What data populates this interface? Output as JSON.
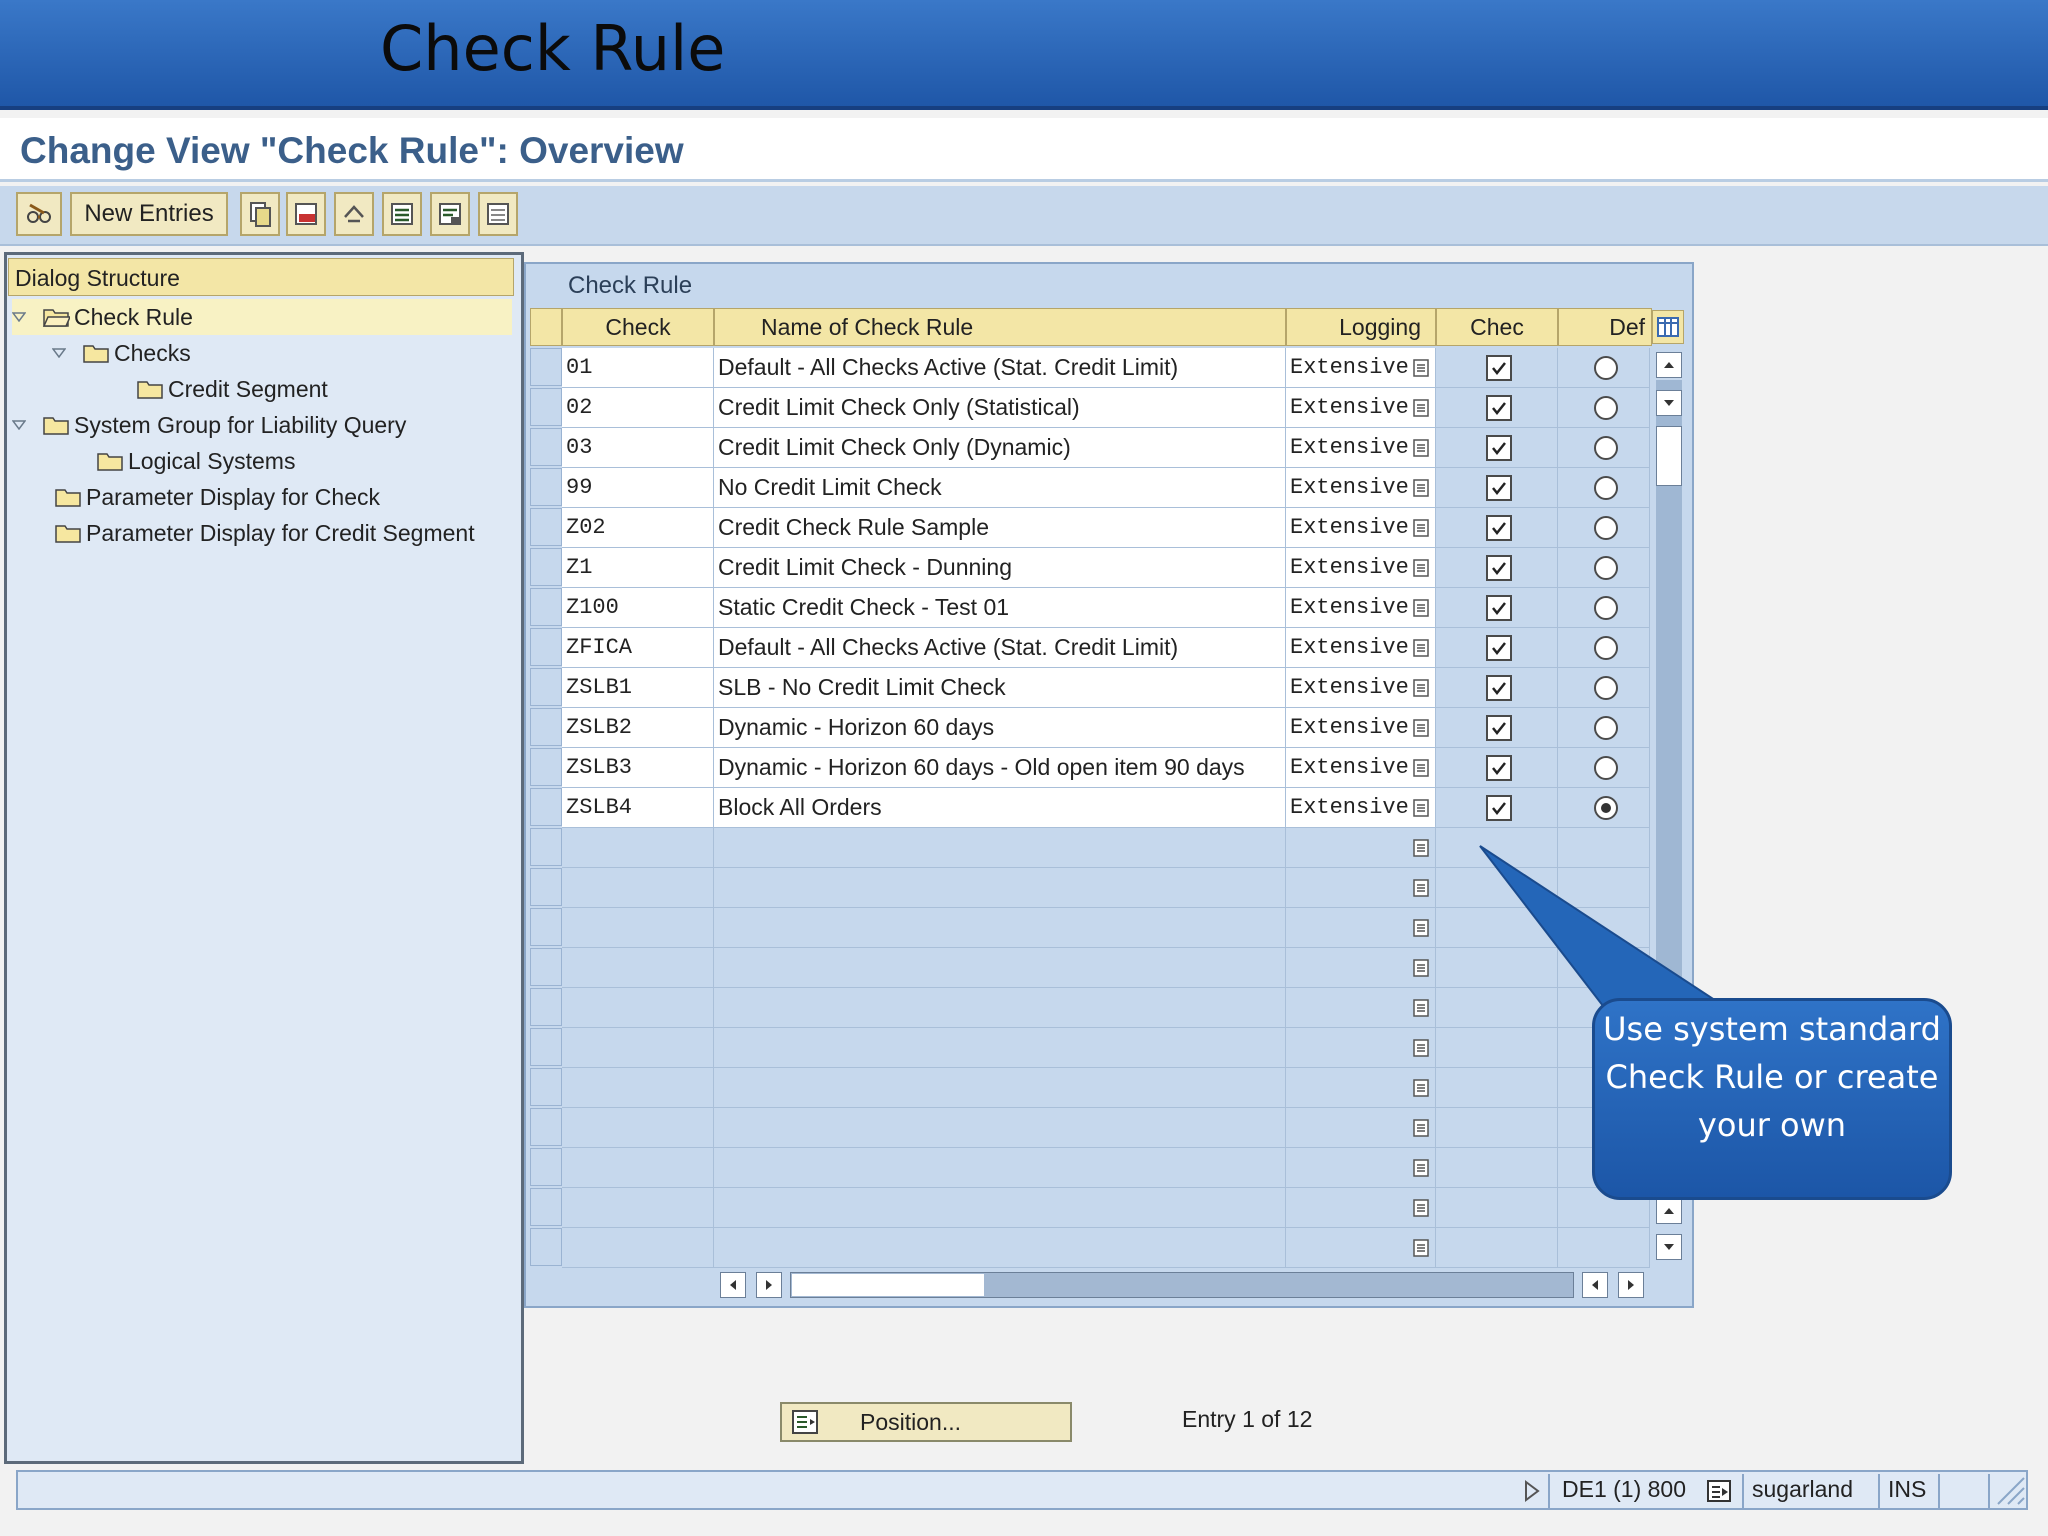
{
  "slide": {
    "title": "Check Rule"
  },
  "view": {
    "title": "Change View \"Check Rule\": Overview"
  },
  "toolbar": {
    "new_entries_label": "New Entries"
  },
  "dialog_structure": {
    "header": "Dialog Structure",
    "items": [
      {
        "label": "Check Rule"
      },
      {
        "label": "Checks"
      },
      {
        "label": "Credit Segment"
      },
      {
        "label": "System Group for Liability Query"
      },
      {
        "label": "Logical Systems"
      },
      {
        "label": "Parameter Display for Check"
      },
      {
        "label": "Parameter Display for Credit Segment"
      }
    ]
  },
  "table": {
    "title": "Check Rule",
    "columns": [
      "Check",
      "Name of Check Rule",
      "Logging",
      "Chec",
      "Def"
    ],
    "rows": [
      {
        "check": "01",
        "name": "Default - All Checks Active (Stat. Credit Limit)",
        "logging": "Extensive",
        "checked": true,
        "default": false
      },
      {
        "check": "02",
        "name": "Credit Limit Check Only (Statistical)",
        "logging": "Extensive",
        "checked": true,
        "default": false
      },
      {
        "check": "03",
        "name": "Credit Limit Check Only (Dynamic)",
        "logging": "Extensive",
        "checked": true,
        "default": false
      },
      {
        "check": "99",
        "name": "No Credit Limit Check",
        "logging": "Extensive",
        "checked": true,
        "default": false
      },
      {
        "check": "Z02",
        "name": "Credit Check Rule Sample",
        "logging": "Extensive",
        "checked": true,
        "default": false
      },
      {
        "check": "Z1",
        "name": "Credit Limit Check - Dunning",
        "logging": "Extensive",
        "checked": true,
        "default": false
      },
      {
        "check": "Z100",
        "name": "Static Credit Check - Test 01",
        "logging": "Extensive",
        "checked": true,
        "default": false
      },
      {
        "check": "ZFICA",
        "name": "Default - All Checks Active (Stat. Credit Limit)",
        "logging": "Extensive",
        "checked": true,
        "default": false
      },
      {
        "check": "ZSLB1",
        "name": "SLB - No Credit Limit Check",
        "logging": "Extensive",
        "checked": true,
        "default": false
      },
      {
        "check": "ZSLB2",
        "name": "Dynamic - Horizon 60 days",
        "logging": "Extensive",
        "checked": true,
        "default": false
      },
      {
        "check": "ZSLB3",
        "name": "Dynamic - Horizon 60 days - Old open item 90 days",
        "logging": "Extensive",
        "checked": true,
        "default": false
      },
      {
        "check": "ZSLB4",
        "name": "Block All Orders",
        "logging": "Extensive",
        "checked": true,
        "default": true
      }
    ],
    "empty_rows": 11
  },
  "callout": {
    "text": "Use system standard Check Rule or create your own"
  },
  "footer": {
    "position_label": "Position...",
    "entry_text": "Entry 1 of 12"
  },
  "statusbar": {
    "system": "DE1 (1) 800",
    "server": "sugarland",
    "mode": "INS"
  },
  "colors": {
    "banner": "#1f57a8",
    "header_yellow": "#f3e6a6",
    "panel_blue": "#c6d8ed"
  }
}
